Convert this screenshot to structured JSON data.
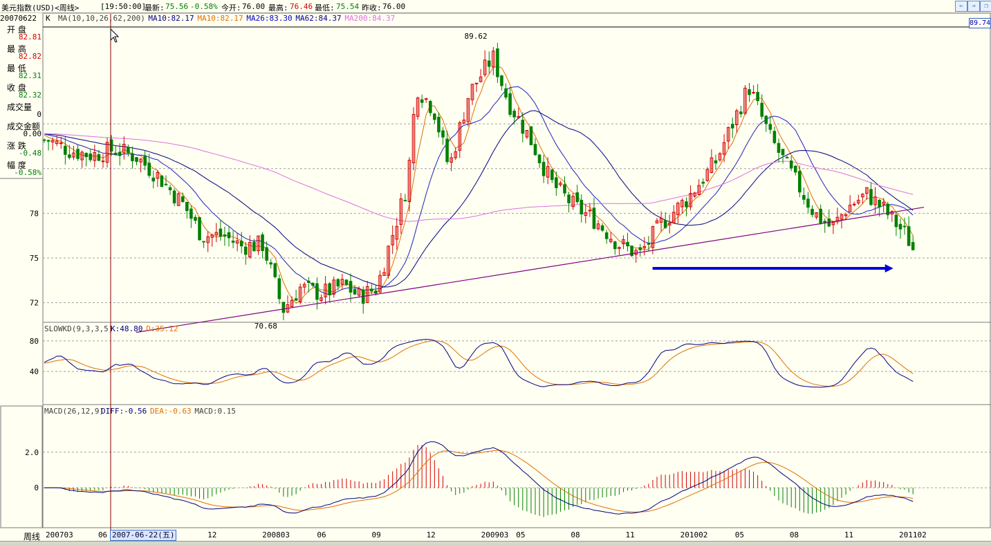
{
  "header": {
    "title": "美元指数(USD)<周线>",
    "time": "[19:50:00]",
    "latest_label": "最新:",
    "latest": "75.56",
    "change": "-0.58%",
    "open_label": "今开:",
    "open": "76.00",
    "high_label": "最高:",
    "high": "76.46",
    "low_label": "最低:",
    "low": "75.54",
    "prev_label": "昨收:",
    "prev": "76.00"
  },
  "info_panel": {
    "date": "20070622",
    "items": [
      {
        "label": "开  盘",
        "value": "82.81",
        "color": "#d40000"
      },
      {
        "label": "最  高",
        "value": "82.82",
        "color": "#d40000"
      },
      {
        "label": "最  低",
        "value": "82.31",
        "color": "#008000"
      },
      {
        "label": "收  盘",
        "value": "82.32",
        "color": "#008000"
      },
      {
        "label": "成交量",
        "value": "0",
        "color": "#000000"
      },
      {
        "label": "成交金额",
        "value": "0.00",
        "color": "#000000"
      },
      {
        "label": "涨  跌",
        "value": "-0.48",
        "color": "#008000"
      },
      {
        "label": "幅  度",
        "value": "-0.58%",
        "color": "#008000"
      }
    ]
  },
  "bottom_label": "周线",
  "selected_date": "2007-06-22(五)",
  "right_price_tag": "89.74",
  "chart_data": [
    {
      "type": "candlestick",
      "period_label": "K",
      "legend": [
        {
          "text": "MA(10,10,26,62,200)",
          "color": "#404040"
        },
        {
          "text": "MA10:82.17",
          "color": "#000080"
        },
        {
          "text": "MA10:82.17",
          "color": "#e07000"
        },
        {
          "text": "MA26:83.30",
          "color": "#0000c0"
        },
        {
          "text": "MA62:84.37",
          "color": "#000090"
        },
        {
          "text": "MA200:84.37",
          "color": "#e070e0"
        }
      ],
      "y_ticks": [
        "78",
        "75",
        "72"
      ],
      "y_tick_values": [
        78,
        75,
        72
      ],
      "ylim": [
        70.68,
        89.62
      ],
      "annotations": [
        {
          "text": "89.62",
          "x": 2009.23,
          "y": 89.62
        },
        {
          "text": "70.68",
          "x": 2008.27,
          "y": 70.68
        }
      ],
      "close_anchors": [
        [
          2007.2,
          82.9
        ],
        [
          2007.3,
          82.2
        ],
        [
          2007.4,
          81.9
        ],
        [
          2007.5,
          82.3
        ],
        [
          2007.6,
          81.8
        ],
        [
          2007.7,
          80.5
        ],
        [
          2007.82,
          78.5
        ],
        [
          2007.9,
          76.5
        ],
        [
          2008.0,
          76.5
        ],
        [
          2008.08,
          75.8
        ],
        [
          2008.18,
          75.9
        ],
        [
          2008.27,
          71.5
        ],
        [
          2008.35,
          73.0
        ],
        [
          2008.45,
          72.6
        ],
        [
          2008.55,
          73.2
        ],
        [
          2008.62,
          72.4
        ],
        [
          2008.7,
          73.0
        ],
        [
          2008.78,
          77.0
        ],
        [
          2008.84,
          80.0
        ],
        [
          2008.88,
          86.5
        ],
        [
          2008.96,
          85.0
        ],
        [
          2009.03,
          81.0
        ],
        [
          2009.12,
          86.0
        ],
        [
          2009.23,
          88.5
        ],
        [
          2009.3,
          85.5
        ],
        [
          2009.4,
          83.0
        ],
        [
          2009.5,
          80.0
        ],
        [
          2009.6,
          78.5
        ],
        [
          2009.7,
          77.5
        ],
        [
          2009.8,
          76.0
        ],
        [
          2009.9,
          75.2
        ],
        [
          2010.0,
          77.3
        ],
        [
          2010.12,
          79.0
        ],
        [
          2010.25,
          81.5
        ],
        [
          2010.4,
          86.5
        ],
        [
          2010.5,
          83.0
        ],
        [
          2010.6,
          80.5
        ],
        [
          2010.7,
          78.0
        ],
        [
          2010.78,
          77.0
        ],
        [
          2010.85,
          78.4
        ],
        [
          2010.94,
          79.3
        ],
        [
          2011.02,
          78.2
        ],
        [
          2011.12,
          76.5
        ],
        [
          2011.15,
          75.6
        ]
      ],
      "ma_lines": [
        {
          "name": "MA10",
          "color": "#e07000",
          "lag": 5
        },
        {
          "name": "MA26",
          "color": "#2020c0",
          "lag": 13
        },
        {
          "name": "MA62",
          "color": "#000080",
          "lag": 30
        },
        {
          "name": "MA200",
          "color": "#e070e0",
          "lag": 90
        }
      ],
      "trendline": {
        "from": [
          2007.6,
          70.0
        ],
        "to": [
          2011.2,
          78.4
        ],
        "color": "#800080"
      },
      "arrow": {
        "from": [
          2009.96,
          74.3
        ],
        "to": [
          2011.06,
          74.3
        ],
        "color": "#0000e0"
      }
    },
    {
      "type": "line",
      "title": "SLOWKD(9,3,3,5)",
      "legend": [
        {
          "text": "K:48.80",
          "color": "#000080"
        },
        {
          "text": "D:35.12",
          "color": "#e07000"
        }
      ],
      "y_ticks": [
        "80",
        "40"
      ],
      "y_tick_values": [
        80,
        40
      ],
      "ylim": [
        13,
        97
      ]
    },
    {
      "type": "bar",
      "title": "MACD(26,12,9)",
      "legend": [
        {
          "text": "DIFF:-0.56",
          "color": "#000080"
        },
        {
          "text": "DEA:-0.63",
          "color": "#e07000"
        },
        {
          "text": "MACD:0.15",
          "color": "#404040"
        }
      ],
      "y_ticks": [
        "2.0",
        "0"
      ],
      "y_tick_values": [
        2.0,
        0
      ],
      "ylim": [
        -2.25,
        4.6
      ]
    }
  ],
  "x_axis": {
    "xlim": [
      2007.18,
      2011.2
    ],
    "ticks": [
      {
        "label": "200703",
        "x": 2007.18
      },
      {
        "label": "06",
        "x": 2007.42
      },
      {
        "label": "12",
        "x": 2007.92
      },
      {
        "label": "200803",
        "x": 2008.17
      },
      {
        "label": "06",
        "x": 2008.42
      },
      {
        "label": "09",
        "x": 2008.67
      },
      {
        "label": "12",
        "x": 2008.92
      },
      {
        "label": "200903",
        "x": 2009.17
      },
      {
        "label": "05",
        "x": 2009.33
      },
      {
        "label": "08",
        "x": 2009.58
      },
      {
        "label": "11",
        "x": 2009.83
      },
      {
        "label": "201002",
        "x": 2010.08
      },
      {
        "label": "05",
        "x": 2010.33
      },
      {
        "label": "08",
        "x": 2010.58
      },
      {
        "label": "11",
        "x": 2010.83
      },
      {
        "label": "201102",
        "x": 2011.08
      }
    ]
  },
  "colors": {
    "background": "#fffff2",
    "up": "#d40000",
    "down": "#008000",
    "grid": "#a0a0a0",
    "cursor": "#800000"
  }
}
